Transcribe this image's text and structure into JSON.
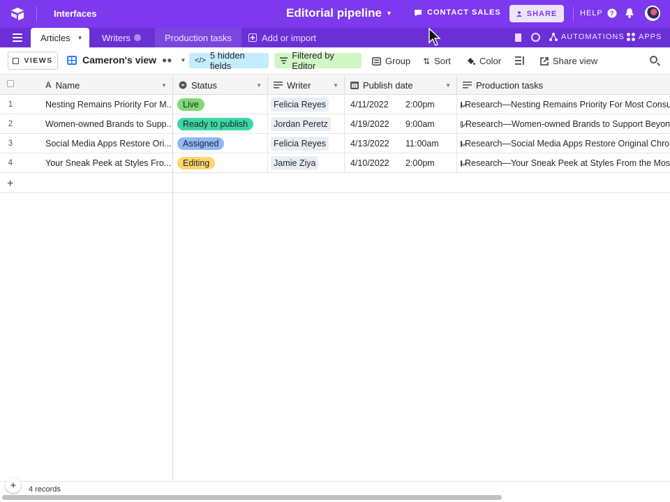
{
  "topbar": {
    "interfaces": "Interfaces",
    "base_title": "Editorial pipeline",
    "contact_sales": "CONTACT SALES",
    "share": "SHARE",
    "help": "HELP",
    "accent": "#7c39ed"
  },
  "tabs": {
    "articles": "Articles",
    "writers": "Writers",
    "production_tasks": "Production tasks",
    "add_import": "Add or import",
    "automations": "AUTOMATIONS",
    "apps": "APPS"
  },
  "toolbar": {
    "views": "VIEWS",
    "view_name": "Cameron's view",
    "hidden_fields": "5 hidden fields",
    "filtered_by": "Filtered by Editor",
    "group": "Group",
    "sort": "Sort",
    "color": "Color",
    "share_view": "Share view"
  },
  "columns": {
    "name": "Name",
    "status": "Status",
    "writer": "Writer",
    "publish_date": "Publish date",
    "production_tasks": "Production tasks"
  },
  "rows": [
    {
      "num": "1",
      "name": "Nesting Remains Priority For M...",
      "status": "Live",
      "status_color": "#7ed975",
      "writer": "Felicia Reyes",
      "date": "4/11/2022",
      "time": "2:00pm",
      "task": "Research—Nesting Remains Priority For Most Consu"
    },
    {
      "num": "2",
      "name": "Women-owned Brands to Supp...",
      "status": "Ready to publish",
      "status_color": "#3ed6a8",
      "writer": "Jordan Peretz",
      "date": "4/19/2022",
      "time": "9:00am",
      "task": "Research—Women-owned Brands to Support Beyon"
    },
    {
      "num": "3",
      "name": "Social Media Apps Restore Ori...",
      "status": "Assigned",
      "status_color": "#8fb8f6",
      "writer": "Felicia Reyes",
      "date": "4/13/2022",
      "time": "11:00am",
      "task": "Research—Social Media Apps Restore Original Chron"
    },
    {
      "num": "4",
      "name": "Your Sneak Peek at Styles Fro...",
      "status": "Editing",
      "status_color": "#ffd66e",
      "writer": "Jamie Ziya",
      "date": "4/10/2022",
      "time": "2:00pm",
      "task": "Research—Your Sneak Peek at Styles From the Most"
    }
  ],
  "footer": {
    "records": "4 records"
  }
}
